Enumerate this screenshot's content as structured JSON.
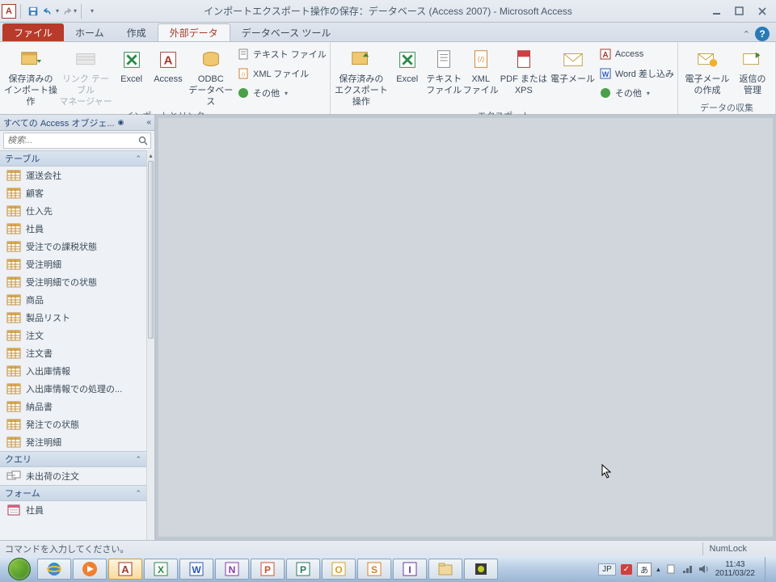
{
  "title": "インポートエクスポート操作の保存：データベース (Access 2007) - Microsoft Access",
  "tabs": {
    "file": "ファイル",
    "home": "ホーム",
    "create": "作成",
    "external": "外部データ",
    "dbtools": "データベース ツール"
  },
  "ribbon": {
    "import_group": "インポートとリンク",
    "export_group": "エクスポート",
    "collect_group": "データの収集",
    "saved_imports": "保存済みの\nインポート操作",
    "link_mgr": "リンク テーブル\nマネージャー",
    "excel": "Excel",
    "access": "Access",
    "odbc": "ODBC\nデータベース",
    "text_file": "テキスト ファイル",
    "xml_file": "XML ファイル",
    "other": "その他",
    "saved_exports": "保存済みの\nエクスポート操作",
    "excel2": "Excel",
    "text_file2": "テキスト\nファイル",
    "xml_file2": "XML\nファイル",
    "pdf_xps": "PDF または\nXPS",
    "email": "電子メール",
    "access2": "Access",
    "word_merge": "Word 差し込み",
    "other2": "その他",
    "email_create": "電子メール\nの作成",
    "reply_mgr": "返信の\n管理"
  },
  "nav": {
    "header": "すべての Access オブジェ...",
    "search_placeholder": "検索...",
    "tables_label": "テーブル",
    "queries_label": "クエリ",
    "forms_label": "フォーム",
    "tables": [
      "運送会社",
      "顧客",
      "仕入先",
      "社員",
      "受注での課税状態",
      "受注明細",
      "受注明細での状態",
      "商品",
      "製品リスト",
      "注文",
      "注文書",
      "入出庫情報",
      "入出庫情報での処理の...",
      "納品書",
      "発注での状態",
      "発注明細"
    ],
    "queries": [
      "未出荷の注文"
    ],
    "forms": [
      "社員"
    ]
  },
  "status": {
    "msg": "コマンドを入力してください。",
    "numlock": "NumLock"
  },
  "tray": {
    "lang": "JP",
    "ime": "あ",
    "time": "11:43",
    "date": "2011/03/22"
  }
}
